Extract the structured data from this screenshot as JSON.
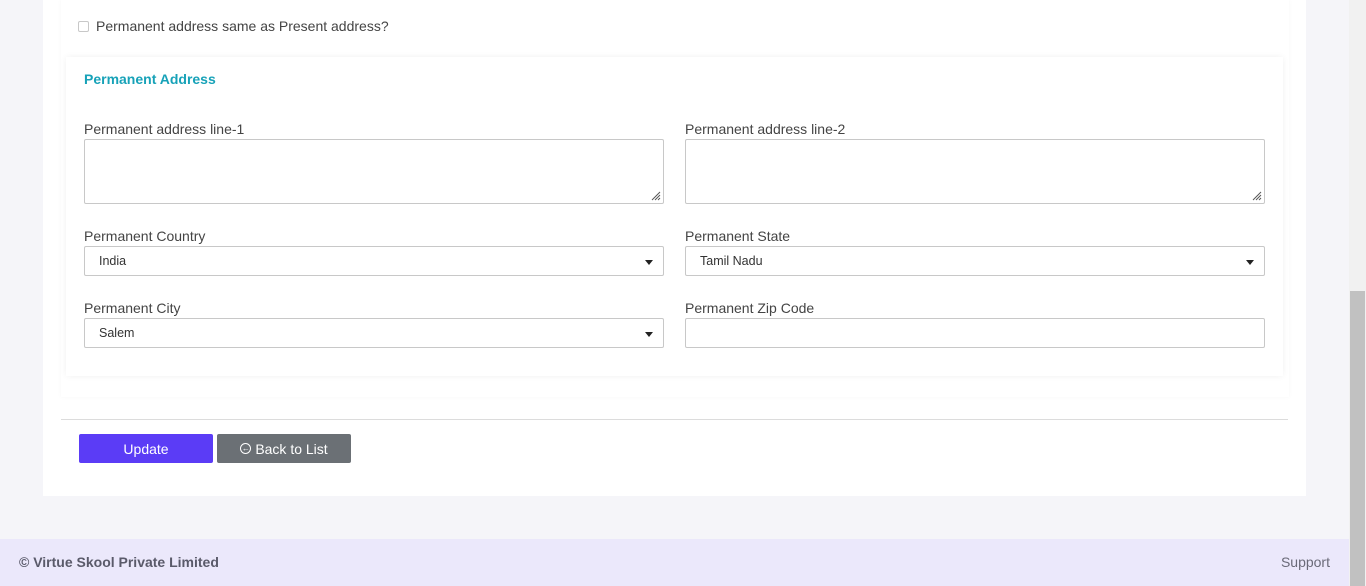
{
  "form": {
    "same_address_checkbox": {
      "label": "Permanent address same as Present address?",
      "checked": false
    },
    "section_title": "Permanent Address",
    "fields": {
      "address_line1": {
        "label": "Permanent address line-1",
        "value": ""
      },
      "address_line2": {
        "label": "Permanent address line-2",
        "value": ""
      },
      "country": {
        "label": "Permanent Country",
        "value": "India"
      },
      "state": {
        "label": "Permanent State",
        "value": "Tamil Nadu"
      },
      "city": {
        "label": "Permanent City",
        "value": "Salem"
      },
      "zip": {
        "label": "Permanent Zip Code",
        "value": ""
      }
    },
    "buttons": {
      "update": "Update",
      "back": "Back to List"
    }
  },
  "footer": {
    "copyright": "© Virtue Skool Private Limited",
    "support": "Support"
  },
  "colors": {
    "section_title": "#17a2b8",
    "update_button": "#5b3cf6",
    "back_button": "#6b7075",
    "footer_bg": "#ebe8fb",
    "page_bg": "#f5f5f9"
  },
  "icons": {
    "back_button_icon": "arrow-circle-left-icon",
    "select_caret": "caret-down-icon"
  }
}
